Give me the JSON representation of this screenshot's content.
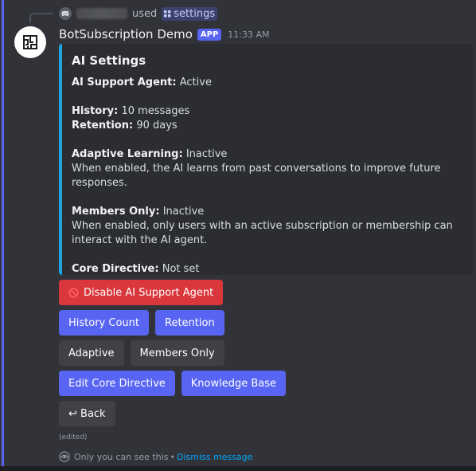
{
  "reply": {
    "used_text": "used",
    "command": "settings"
  },
  "message": {
    "username": "BotSubscription Demo",
    "app_tag": "APP",
    "timestamp": "11:33 AM"
  },
  "embed": {
    "title": "AI Settings",
    "accent_color": "#1ea7e1",
    "fields": {
      "agent_label": "AI Support Agent:",
      "agent_value": "Active",
      "history_label": "History:",
      "history_value": "10 messages",
      "retention_label": "Retention:",
      "retention_value": "90 days",
      "adaptive_label": "Adaptive Learning:",
      "adaptive_value": "Inactive",
      "adaptive_desc": "When enabled, the AI learns from past conversations to improve future responses.",
      "members_label": "Members Only:",
      "members_value": "Inactive",
      "members_desc": "When enabled, only users with an active subscription or membership can interact with the AI agent.",
      "directive_label": "Core Directive:",
      "directive_value": "Not set"
    }
  },
  "buttons": {
    "disable_agent": "Disable AI Support Agent",
    "history_count": "History Count",
    "retention": "Retention",
    "adaptive": "Adaptive",
    "members_only": "Members Only",
    "edit_directive": "Edit Core Directive",
    "knowledge_base": "Knowledge Base",
    "back": "↩ Back"
  },
  "footer": {
    "edited": "(edited)",
    "only_you": "Only you can see this",
    "separator": "•",
    "dismiss": "Dismiss message"
  },
  "colors": {
    "brand": "#5865f2",
    "danger": "#da373c",
    "secondary": "#3f4147",
    "link": "#00a8fc"
  }
}
